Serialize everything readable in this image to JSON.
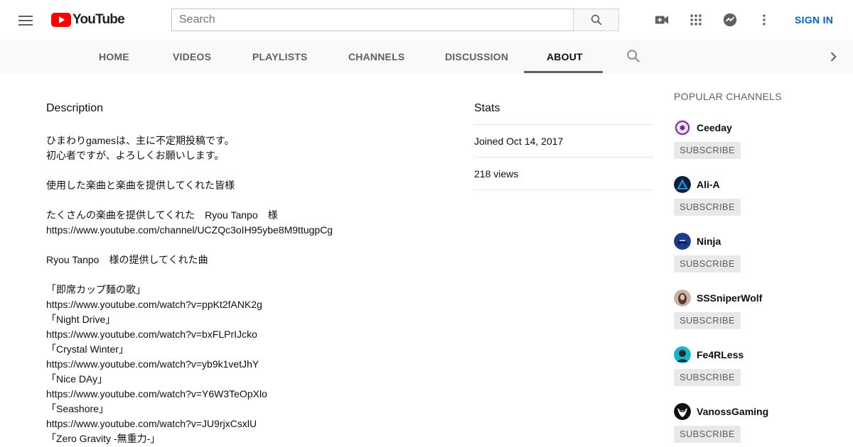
{
  "masthead": {
    "logo_text": "YouTube",
    "search_placeholder": "Search",
    "sign_in": "SIGN IN"
  },
  "tabs": [
    {
      "label": "HOME"
    },
    {
      "label": "VIDEOS"
    },
    {
      "label": "PLAYLISTS"
    },
    {
      "label": "CHANNELS"
    },
    {
      "label": "DISCUSSION"
    },
    {
      "label": "ABOUT"
    }
  ],
  "about": {
    "description_heading": "Description",
    "description_lines": [
      "ひまわりgamesは、主に不定期投稿です。",
      "初心者ですが、よろしくお願いします。",
      "",
      "使用した楽曲と楽曲を提供してくれた皆様",
      "",
      "たくさんの楽曲を提供してくれた　Ryou Tanpo　様",
      "https://www.youtube.com/channel/UCZQc3oIH95ybe8M9ttugpCg",
      "",
      "Ryou Tanpo　様の提供してくれた曲",
      "",
      "「即席カップ麺の歌」",
      "https://www.youtube.com/watch?v=ppKt2fANK2g",
      "「Night Drive」",
      "https://www.youtube.com/watch?v=bxFLPrIJcko",
      "「Crystal Winter」",
      "https://www.youtube.com/watch?v=yb9k1vetJhY",
      "「Nice DAy」",
      "https://www.youtube.com/watch?v=Y6W3TeOpXlo",
      "「Seashore」",
      "https://www.youtube.com/watch?v=JU9rjxCsxlU",
      "「Zero Gravity -無重力-」"
    ],
    "stats_heading": "Stats",
    "joined": "Joined Oct 14, 2017",
    "views": "218 views"
  },
  "popular_channels": {
    "heading": "POPULAR CHANNELS",
    "subscribe_label": "SUBSCRIBE",
    "items": [
      {
        "name": "Ceeday",
        "avatar_color": "#7b2d8e"
      },
      {
        "name": "Ali-A",
        "avatar_color": "#1a8fe0"
      },
      {
        "name": "Ninja",
        "avatar_color": "#1e3a8a"
      },
      {
        "name": "SSSniperWolf",
        "avatar_color": "#5a3a2e"
      },
      {
        "name": "Fe4RLess",
        "avatar_color": "#18b5c9"
      },
      {
        "name": "VanossGaming",
        "avatar_color": "#111111"
      }
    ]
  },
  "colors": {
    "brand_red": "#ff0000",
    "link_blue": "#065fd4"
  }
}
